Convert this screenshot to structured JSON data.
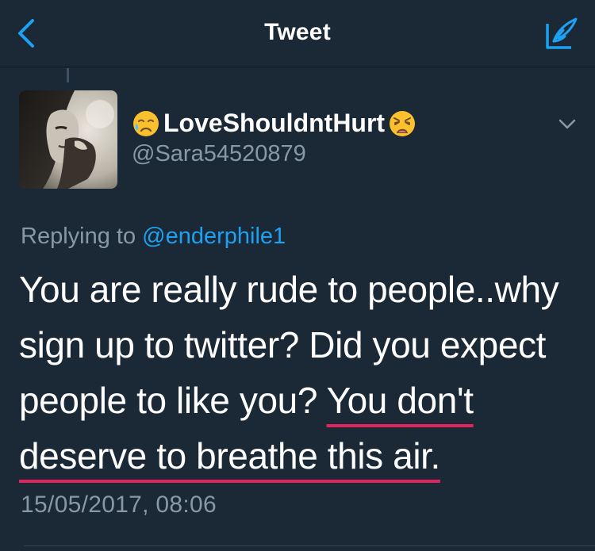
{
  "header": {
    "title": "Tweet",
    "back_icon": "chevron-left-icon",
    "compose_icon": "compose-quill-icon"
  },
  "tweet": {
    "display_name": "LoveShouldntHurt",
    "name_emoji_left": "sad-relieved-face-emoji",
    "name_emoji_right": "weary-face-emoji",
    "handle": "@Sara54520879",
    "reply_prefix": "Replying to ",
    "reply_mention": "@enderphile1",
    "text_plain": "You are really rude to people..why sign up to twitter? Did you expect people to like you? ",
    "text_underlined": "You don't deserve to breathe this air.",
    "timestamp": "15/05/2017, 08:06"
  },
  "colors": {
    "background": "#1b2836",
    "link": "#1da1f2",
    "secondary_text": "#8899a6",
    "underline": "#e0245e"
  }
}
